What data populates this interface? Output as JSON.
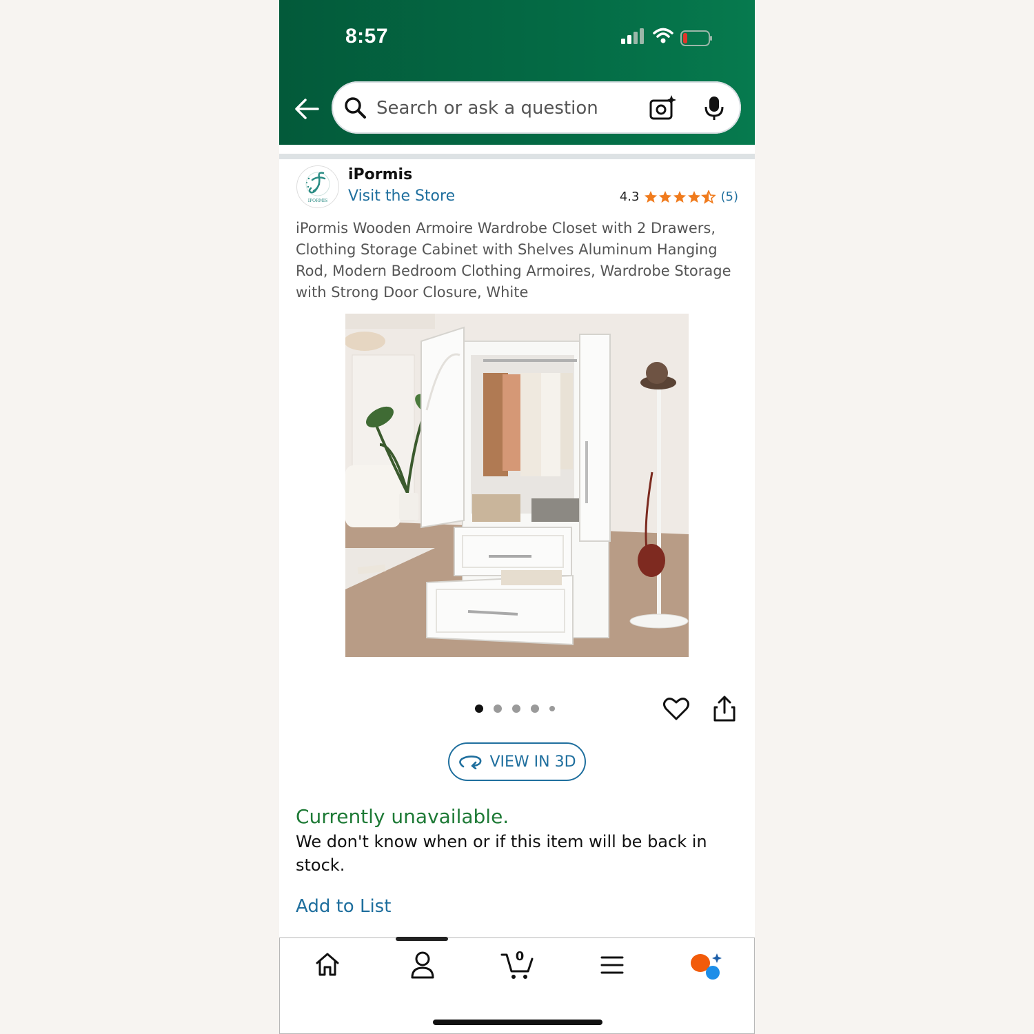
{
  "status_bar": {
    "time": "8:57"
  },
  "search": {
    "placeholder": "Search or ask a question"
  },
  "store": {
    "name": "iPormis",
    "logo_text": "IPORMIS",
    "visit_label": "Visit the Store"
  },
  "rating": {
    "value": "4.3",
    "count": "(5)",
    "stars": 4.3
  },
  "product": {
    "title": "iPormis Wooden Armoire Wardrobe Closet with 2 Drawers, Clothing Storage Cabinet with Shelves Aluminum Hanging Rod, Modern Bedroom Clothing Armoires, Wardrobe Storage with Strong Door Closure, White",
    "image_count": 5,
    "active_image": 1
  },
  "actions": {
    "view_3d": "VIEW IN 3D",
    "add_to_list": "Add to List"
  },
  "availability": {
    "status": "Currently unavailable.",
    "description": "We don't know when or if this item will be back in stock."
  },
  "bottom_nav": {
    "items": [
      {
        "icon": "home-icon"
      },
      {
        "icon": "account-icon"
      },
      {
        "icon": "cart-icon",
        "badge": "0"
      },
      {
        "icon": "menu-icon"
      },
      {
        "icon": "rufus-assistant-icon"
      }
    ]
  },
  "colors": {
    "header_green": "#046b45",
    "link_blue": "#1f6f9e",
    "star_orange": "#f07b1d",
    "unavailable_green": "#1e7a36"
  }
}
